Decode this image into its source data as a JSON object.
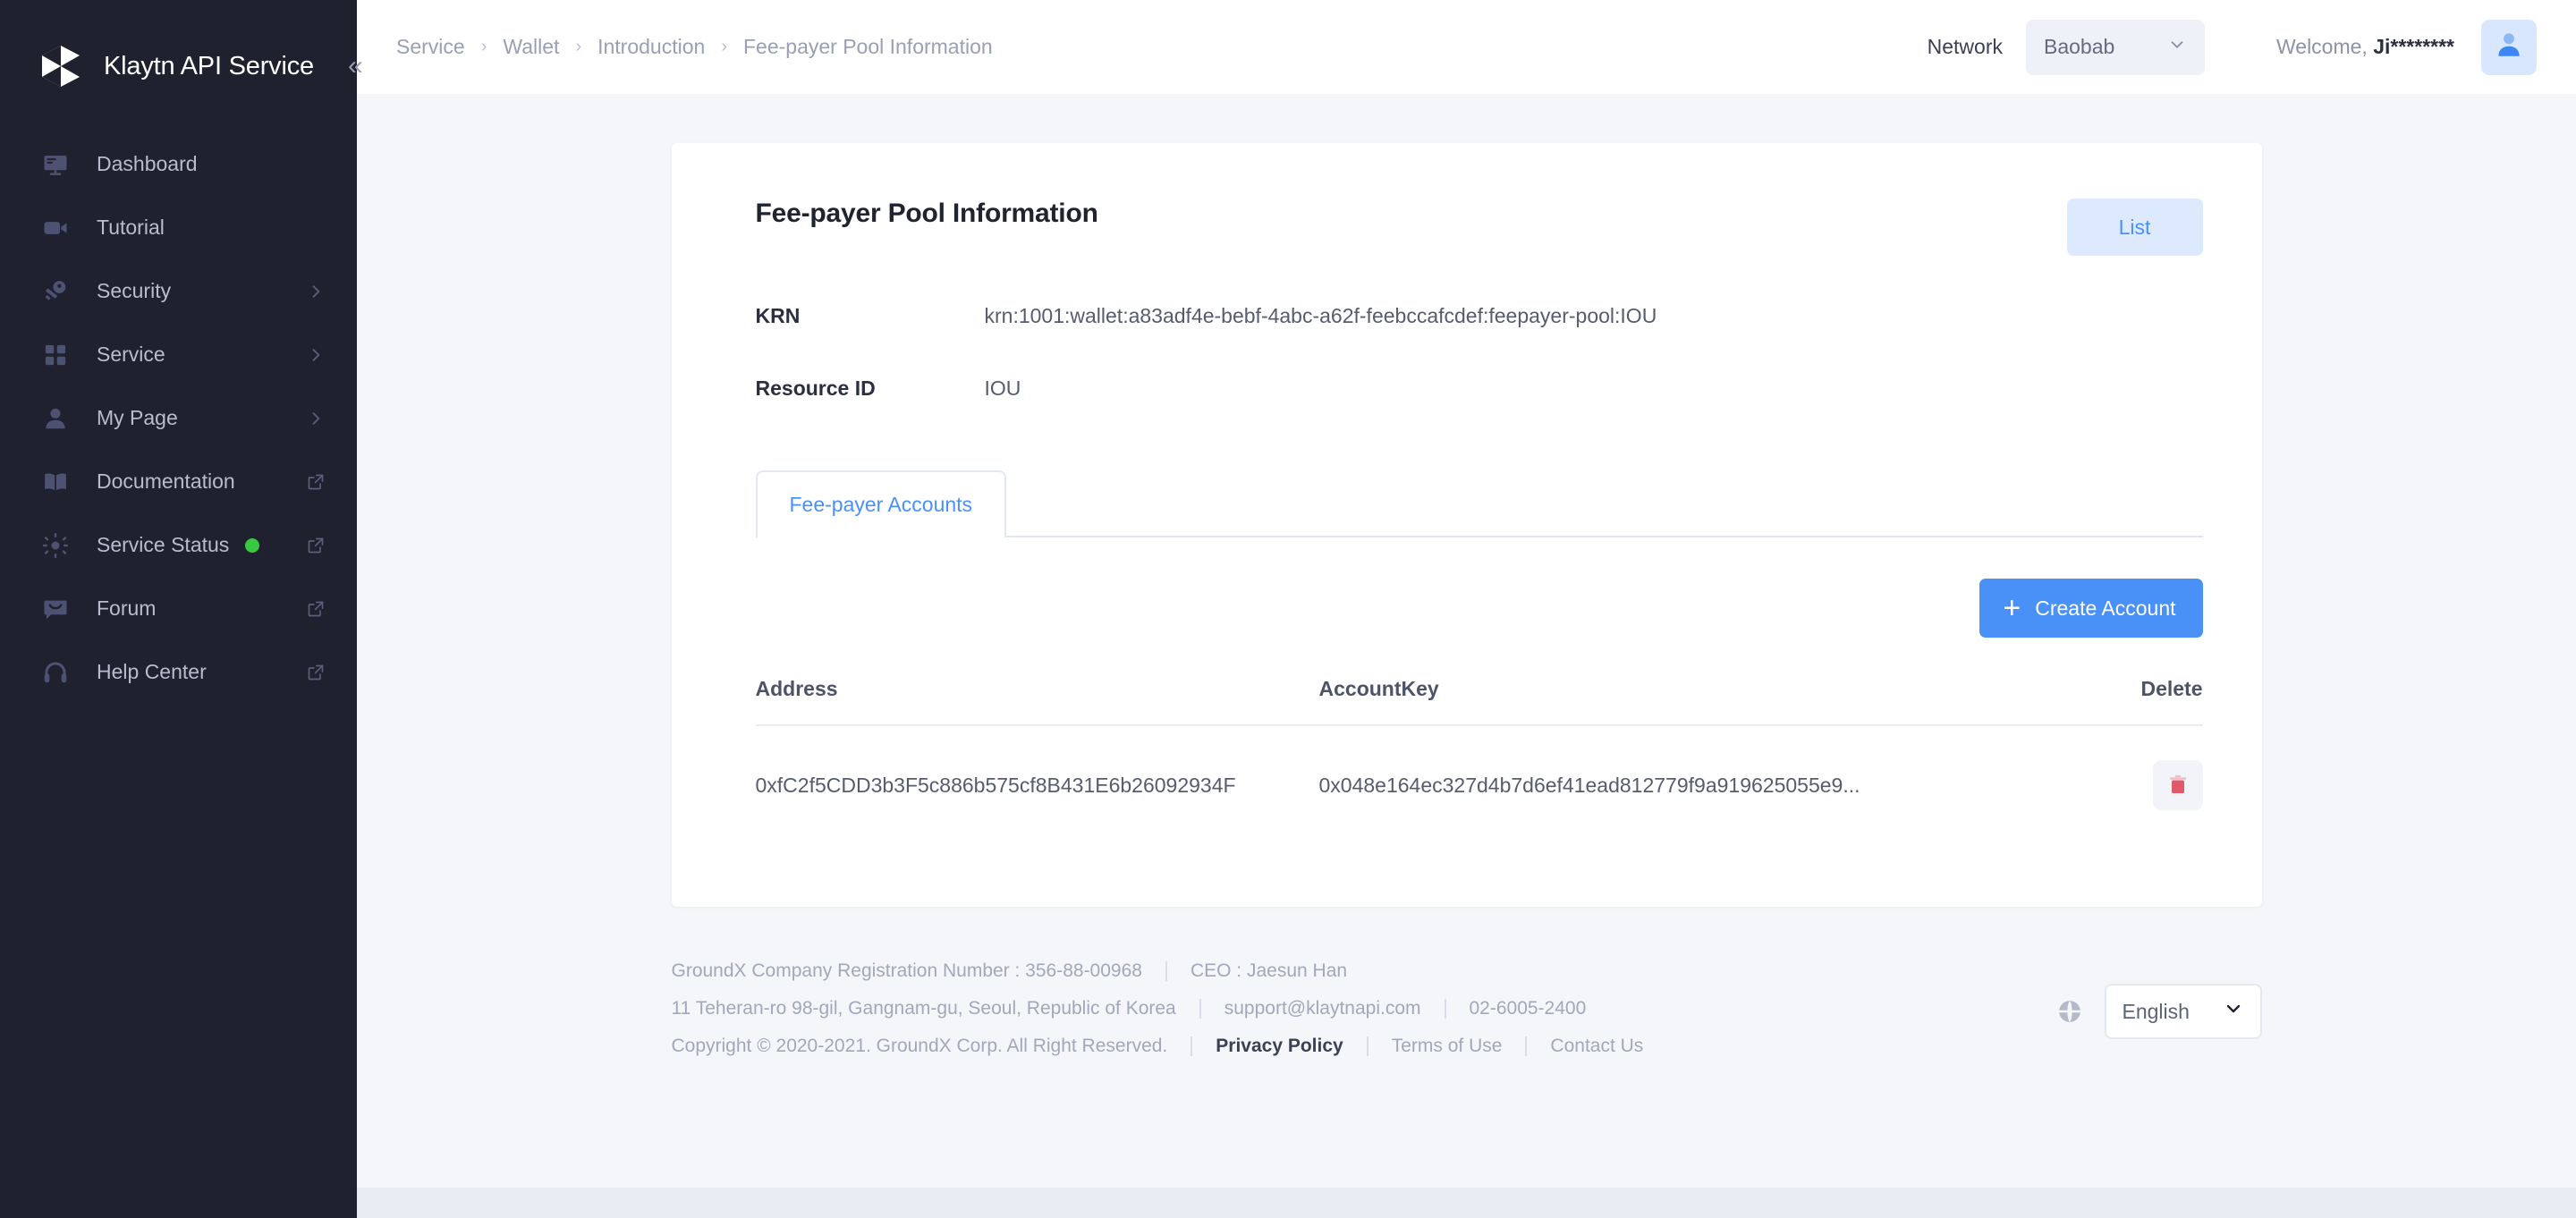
{
  "sidebar": {
    "brand": "Klaytn API Service",
    "collapse_icon": "double-chevron-left-icon",
    "items": [
      {
        "label": "Dashboard",
        "icon": "monitor-icon",
        "right": "none"
      },
      {
        "label": "Tutorial",
        "icon": "video-camera-icon",
        "right": "none"
      },
      {
        "label": "Security",
        "icon": "key-icon",
        "right": "chevron-right-icon"
      },
      {
        "label": "Service",
        "icon": "grid-icon",
        "right": "chevron-right-icon"
      },
      {
        "label": "My Page",
        "icon": "person-icon",
        "right": "chevron-right-icon"
      },
      {
        "label": "Documentation",
        "icon": "book-icon",
        "right": "external-link-icon"
      },
      {
        "label": "Service Status",
        "icon": "sun-status-icon",
        "right": "external-link-icon",
        "status": "online"
      },
      {
        "label": "Forum",
        "icon": "chat-bubble-icon",
        "right": "external-link-icon"
      },
      {
        "label": "Help Center",
        "icon": "headset-icon",
        "right": "external-link-icon"
      }
    ]
  },
  "topbar": {
    "breadcrumb": [
      "Service",
      "Wallet",
      "Introduction",
      "Fee-payer Pool Information"
    ],
    "network_label": "Network",
    "network_value": "Baobab",
    "welcome_prefix": "Welcome, ",
    "welcome_user": "Ji********",
    "avatar_icon": "user-avatar-icon"
  },
  "card": {
    "title": "Fee-payer Pool Information",
    "list_button": "List",
    "fields": [
      {
        "label": "KRN",
        "value": "krn:1001:wallet:a83adf4e-bebf-4abc-a62f-feebccafcdef:feepayer-pool:IOU"
      },
      {
        "label": "Resource ID",
        "value": "IOU"
      }
    ],
    "tabs": [
      {
        "label": "Fee-payer Accounts",
        "active": true
      }
    ],
    "create_button": "Create Account",
    "table": {
      "headers": [
        "Address",
        "AccountKey",
        "Delete"
      ],
      "rows": [
        {
          "address": "0xfC2f5CDD3b3F5c886b575cf8B431E6b26092934F",
          "account_key": "0x048e164ec327d4b7d6ef41ead812779f9a919625055e9...",
          "delete_icon": "trash-icon"
        }
      ]
    }
  },
  "footer": {
    "registration": "GroundX Company Registration Number : 356-88-00968",
    "ceo": "CEO : Jaesun Han",
    "address": "11 Teheran-ro 98-gil, Gangnam-gu, Seoul, Republic of Korea",
    "email": "support@klaytnapi.com",
    "phone": "02-6005-2400",
    "copyright": "Copyright © 2020-2021. GroundX Corp. All Right Reserved.",
    "privacy": "Privacy Policy",
    "terms": "Terms of Use",
    "contact": "Contact Us",
    "language": "English",
    "globe_icon": "globe-icon"
  },
  "colors": {
    "sidebar_bg": "#20212e",
    "accent_blue": "#4a91f7",
    "accent_blue_soft": "#ddeafd",
    "status_green": "#37c93f",
    "delete_red": "#e1586a",
    "page_bg": "#f4f6fa"
  }
}
